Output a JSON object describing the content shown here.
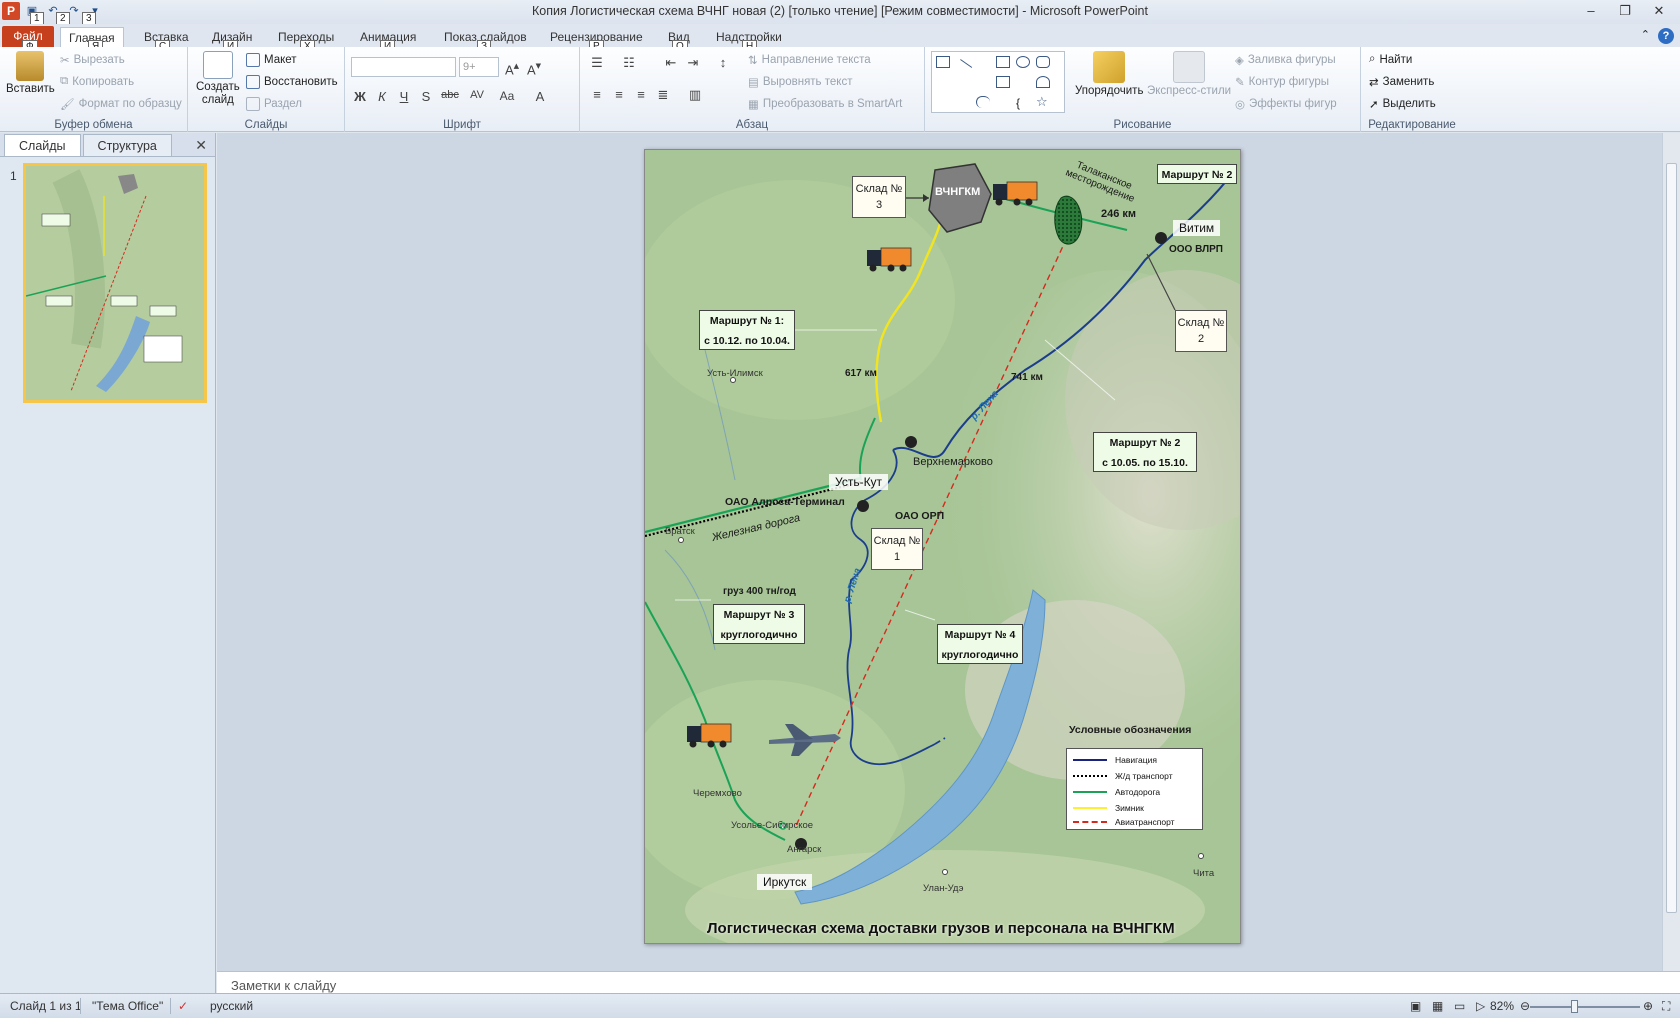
{
  "titlebar": {
    "title": "Копия Логистическая схема ВЧНГ новая (2) [только чтение] [Режим совместимости] - Microsoft PowerPoint",
    "app_icon": "P",
    "qat_keytips": [
      "1",
      "2",
      "3"
    ],
    "minimize": "–",
    "restore": "❐",
    "close": "✕"
  },
  "tabs": [
    {
      "label": "Файл",
      "keytip": "Ф"
    },
    {
      "label": "Главная",
      "keytip": "Я"
    },
    {
      "label": "Вставка",
      "keytip": "С"
    },
    {
      "label": "Дизайн",
      "keytip": "И"
    },
    {
      "label": "Переходы",
      "keytip": "Х"
    },
    {
      "label": "Анимация",
      "keytip": "И"
    },
    {
      "label": "Показ слайдов",
      "keytip": "З"
    },
    {
      "label": "Рецензирование",
      "keytip": "Р"
    },
    {
      "label": "Вид",
      "keytip": "О"
    },
    {
      "label": "Надстройки",
      "keytip": "Н"
    }
  ],
  "ribbon": {
    "clipboard": {
      "paste": "Вставить",
      "cut": "Вырезать",
      "copy": "Копировать",
      "format_painter": "Формат по образцу",
      "label": "Буфер обмена"
    },
    "slides": {
      "new_slide_1": "Создать",
      "new_slide_2": "слайд",
      "layout": "Макет",
      "reset": "Восстановить",
      "section": "Раздел",
      "label": "Слайды"
    },
    "font": {
      "size": "9+",
      "label": "Шрифт",
      "bold": "Ж",
      "italic": "К",
      "underline": "Ч",
      "strike": "S",
      "abc": "abc",
      "spacing": "AV",
      "case": "Aa",
      "color": "A"
    },
    "paragraph": {
      "text_direction": "Направление текста",
      "align_text": "Выровнять текст",
      "smartart": "Преобразовать в SmartArt",
      "label": "Абзац"
    },
    "drawing": {
      "arrange": "Упорядочить",
      "quick_styles": "Экспресс-стили",
      "shape_fill": "Заливка фигуры",
      "shape_outline": "Контур фигуры",
      "shape_effects": "Эффекты фигур",
      "label": "Рисование"
    },
    "editing": {
      "find": "Найти",
      "replace": "Заменить",
      "select": "Выделить",
      "label": "Редактирование"
    }
  },
  "left_panel": {
    "tab_slides": "Слайды",
    "tab_outline": "Структура",
    "slide_number": "1"
  },
  "slide": {
    "title": "Логистическая схема доставки грузов и персонала на ВЧНГКМ",
    "field_label": "ВЧНГКМ",
    "talakan": "Талаканское месторождение",
    "route2_top": "Маршрут № 2",
    "distance_246": "246  км",
    "vitim": "Витим",
    "vlrp": "ООО ВЛРП",
    "warehouse3": "Склад № 3",
    "warehouse2": "Склад № 2",
    "warehouse1": "Склад № 1",
    "route1_line1": "Маршрут № 1:",
    "route1_line2": "с 10.12.  по 10.04.",
    "distance_617": "617 км",
    "distance_741": "741 км",
    "ust_ilimsk": "Усть-Илимск",
    "lena_river": "р. Лена",
    "verkhnemarkovo": "Верхнемарково",
    "route2_line1": "Маршрут № 2",
    "route2_line2": "с 10.05.  по 15.10.",
    "ust_kut": "Усть-Кут",
    "alrosa": "ОАО Алроса-Терминал",
    "orp": "ОАО ОРП",
    "bratsk": "Братск",
    "railway": "Железная дорога",
    "cargo": "груз 400  тн/год",
    "route3_line1": "Маршрут № 3",
    "route3_line2": "круглогодично",
    "route4_line1": "Маршрут № 4",
    "route4_line2": "круглогодично",
    "cheremkhovo": "Черемхово",
    "usolye": "Усолье-Сибирское",
    "angarsk": "Ангарск",
    "irkutsk": "Иркутск",
    "ulan_ude": "Улан-Удэ",
    "chita": "Чита",
    "legend": {
      "title": "Условные  обозначения",
      "items": [
        {
          "label": "Навигация",
          "color": "#1a237e"
        },
        {
          "label": "Ж/д транспорт",
          "color": "#000000"
        },
        {
          "label": "Автодорога",
          "color": "#1aa356"
        },
        {
          "label": "Зимник",
          "color": "#ffee33"
        },
        {
          "label": "Авиатранспорт",
          "color": "#d62a1e"
        }
      ]
    }
  },
  "notes_placeholder": "Заметки к слайду",
  "status": {
    "slide_counter": "Слайд 1 из 1",
    "theme": "\"Тема Office\"",
    "language": "русский",
    "zoom": "82%"
  }
}
